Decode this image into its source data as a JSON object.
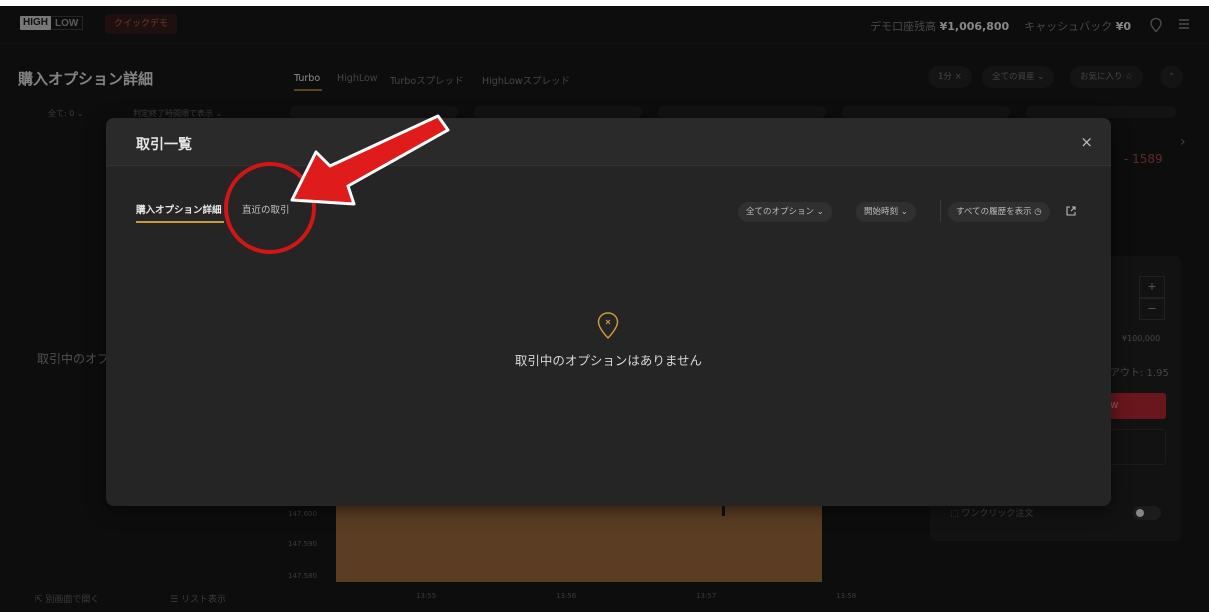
{
  "header": {
    "logo_high": "HIGH",
    "logo_low": "LOW",
    "demo_label": "クイックデモ",
    "balance_label": "デモ口座残高",
    "balance_value": "¥1,006,800",
    "cashback_label": "キャッシュバック",
    "cashback_value": "¥0",
    "icons": [
      "location-icon",
      "menu-icon"
    ]
  },
  "left_panel": {
    "title": "購入オプション詳細",
    "filter_all": "全て: 0 ⌄",
    "filter_sort": "判定終了時間順で表示 ⌄",
    "empty_partial": "取引中のオプ",
    "open_window": "別画面で開く",
    "list_view": "リスト表示"
  },
  "product_tabs": [
    "Turbo",
    "HighLow",
    "Turboスプレッド",
    "HighLowスプレッド"
  ],
  "product_active": "Turbo",
  "pills": {
    "duration": "1分 ×",
    "assets": "全ての資産 ⌄",
    "favorites": "お気に入り ☆"
  },
  "chart": {
    "y_labels": [
      "147.600",
      "147.590",
      "147.580"
    ],
    "x_labels": [
      "13:55",
      "13:56",
      "13:57",
      "13:58"
    ],
    "partial_red_value": "- 1589"
  },
  "trade_panel": {
    "amount_max": "¥100,000",
    "payout_partial": "アウト: 1.95",
    "low_partial": "OW",
    "one_click": "ワンクリック注文"
  },
  "modal": {
    "title": "取引一覧",
    "close": "×",
    "tab_details": "購入オプション詳細",
    "tab_recent": "直近の取引",
    "filter_options": "全てのオプション ⌄",
    "filter_start": "開始時刻 ⌄",
    "show_history": "すべての履歴を表示 ◷",
    "empty_message": "取引中のオプションはありません"
  },
  "annotation_color": "#d11616",
  "accent_color": "#c79a3c"
}
